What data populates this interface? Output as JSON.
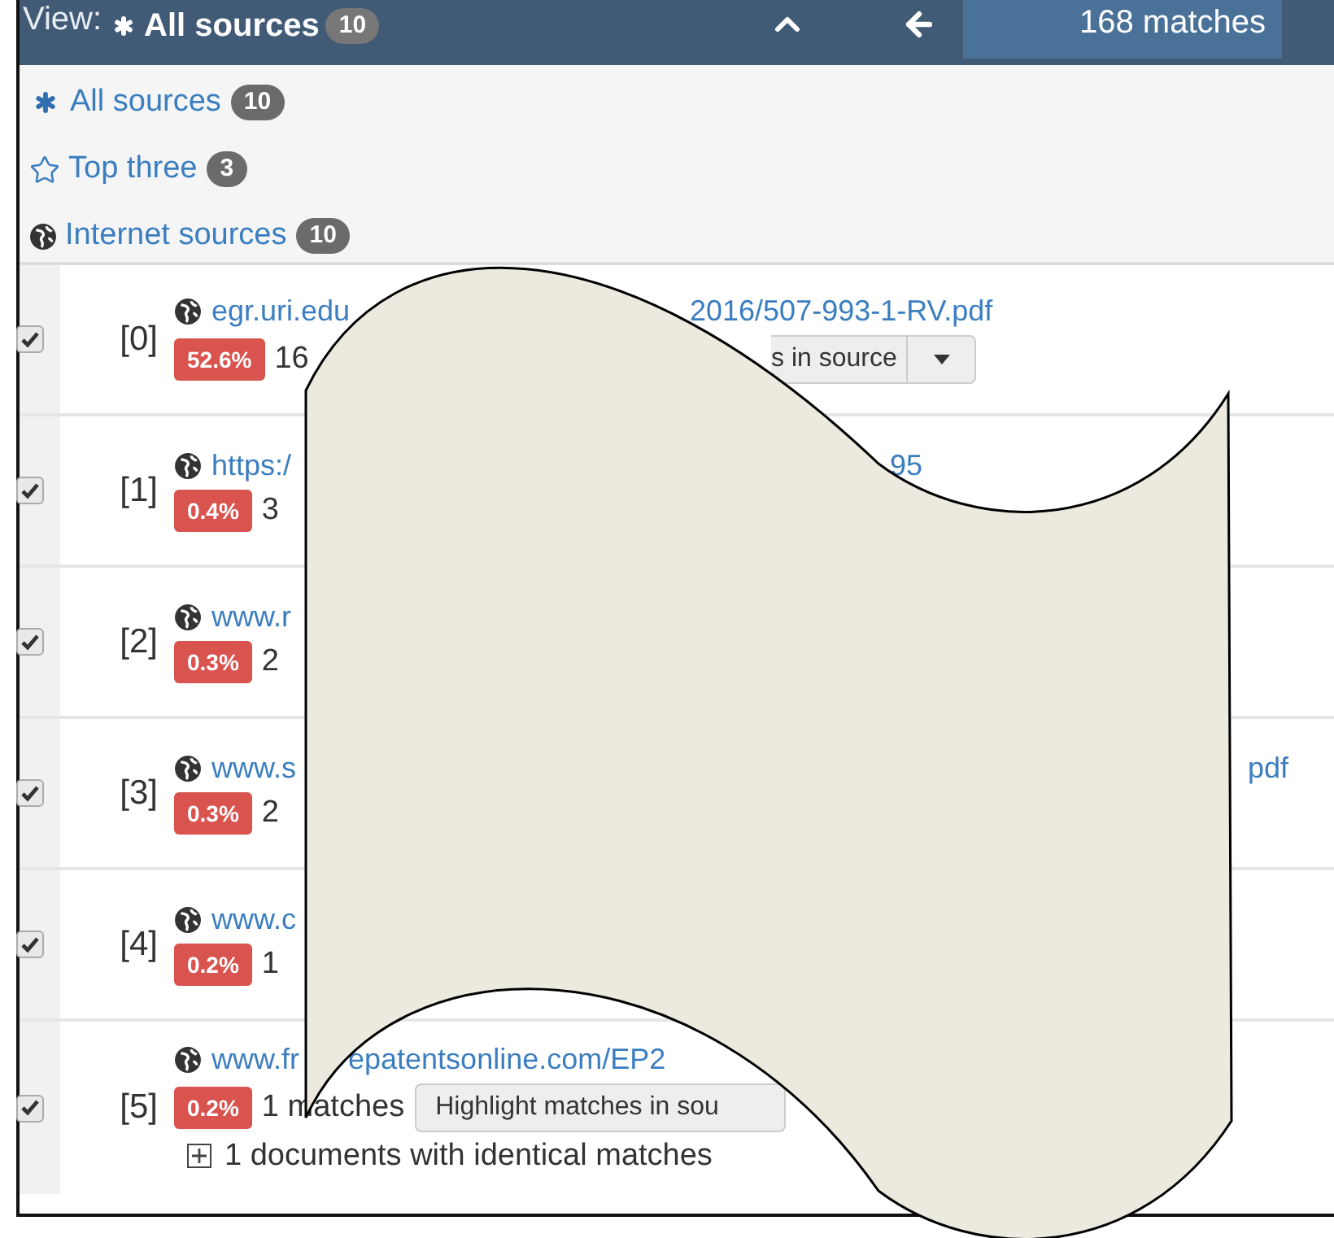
{
  "header": {
    "view_label": "View:",
    "view_value": "All sources",
    "view_count": "10",
    "matches": "168 matches"
  },
  "filters": [
    {
      "kind": "all",
      "label": "All sources",
      "count": "10"
    },
    {
      "kind": "top",
      "label": "Top three",
      "count": "3"
    },
    {
      "kind": "internet",
      "label": "Internet sources",
      "count": "10"
    }
  ],
  "sources": [
    {
      "index": "[0]",
      "checked": true,
      "link": "egr.uri.edu",
      "link_tail": "2016/507-993-1-RV.pdf",
      "percent": "52.6%",
      "matches": "16",
      "button": "s in source",
      "dropdown": true
    },
    {
      "index": "[1]",
      "checked": true,
      "link": "https:/",
      "link_tail": "95",
      "percent": "0.4%",
      "matches": "3"
    },
    {
      "index": "[2]",
      "checked": true,
      "link": "www.r",
      "percent": "0.3%",
      "matches": "2"
    },
    {
      "index": "[3]",
      "checked": true,
      "link": "www.s",
      "link_tail": "pdf",
      "percent": "0.3%",
      "matches": "2"
    },
    {
      "index": "[4]",
      "checked": true,
      "link": "www.c",
      "percent": "0.2%",
      "matches": "1"
    },
    {
      "index": "[5]",
      "checked": true,
      "link": "www.fr",
      "link_tail": "epatentsonline.com/EP2",
      "percent": "0.2%",
      "matches": "1 matches",
      "button": "Highlight matches in sou",
      "identical": "1 documents with identical matches"
    }
  ]
}
